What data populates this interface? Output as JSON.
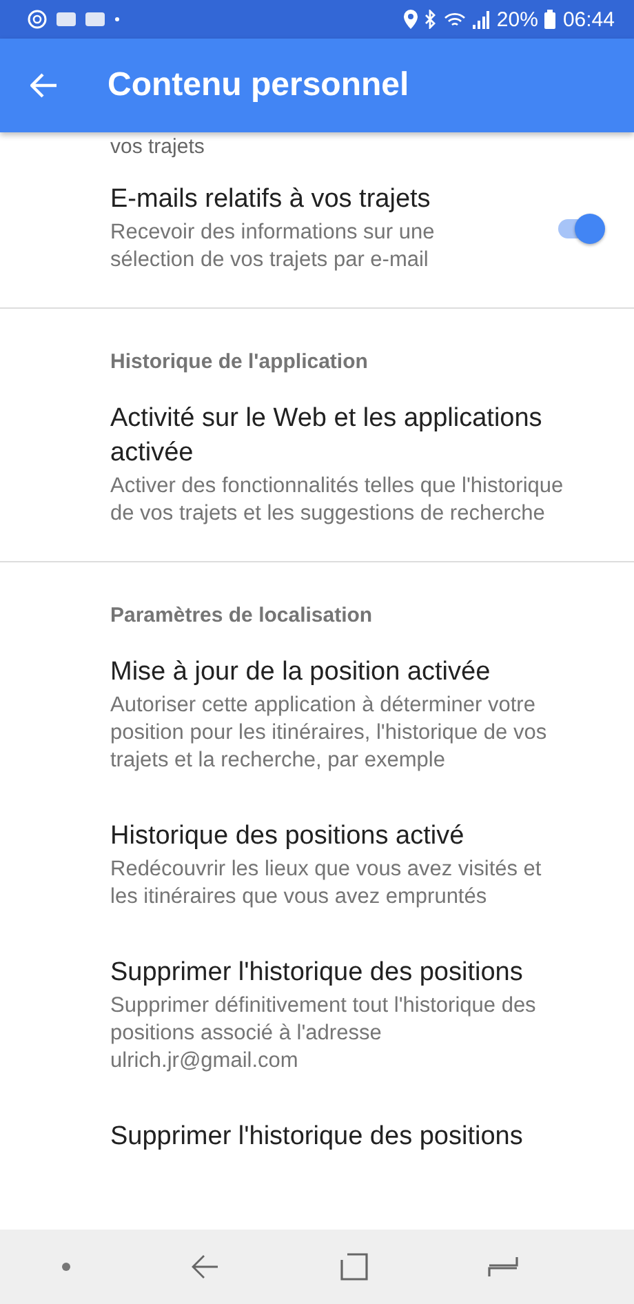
{
  "status_bar": {
    "time": "06:44",
    "battery": "20%"
  },
  "app_bar": {
    "title": "Contenu personnel"
  },
  "cut_top_text": "vos trajets",
  "sections": [
    {
      "items": [
        {
          "title": "E-mails relatifs à vos trajets",
          "subtitle": "Recevoir des informations sur une sélection de vos trajets par e-mail",
          "kind": "toggle",
          "on": true
        }
      ]
    },
    {
      "header": "Historique de l'application",
      "items": [
        {
          "title": "Activité sur le Web et les applications activée",
          "subtitle": "Activer des fonctionnalités telles que l'historique de vos trajets et les suggestions de recherche",
          "kind": "plain"
        }
      ]
    },
    {
      "header": "Paramètres de localisation",
      "items": [
        {
          "title": "Mise à jour de la position activée",
          "subtitle": "Autoriser cette application à déterminer votre position pour les itinéraires, l'historique de vos trajets et la recherche, par exemple",
          "kind": "plain"
        },
        {
          "title": "Historique des positions activé",
          "subtitle": "Redécouvrir les lieux que vous avez visités et les itinéraires que vous avez empruntés",
          "kind": "plain"
        },
        {
          "title": "Supprimer l'historique des positions",
          "subtitle": "Supprimer définitivement tout l'historique des positions associé à l'adresse ulrich.jr@gmail.com",
          "kind": "plain"
        },
        {
          "title": "Supprimer l'historique des positions",
          "kind": "plain"
        }
      ]
    }
  ]
}
